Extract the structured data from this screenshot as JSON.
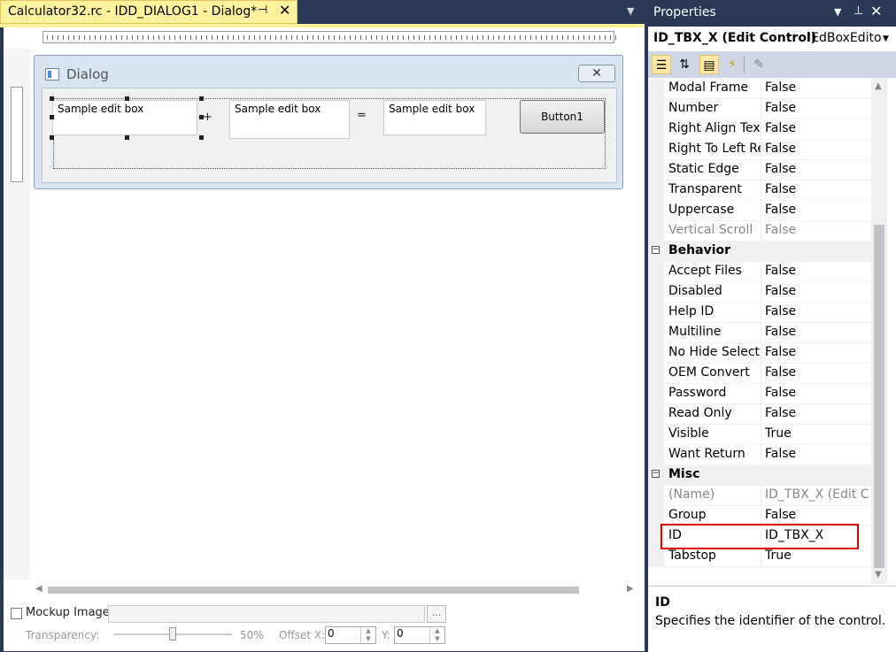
{
  "document": {
    "tab_title": "Calculator32.rc - IDD_DIALOG1 - Dialog*",
    "pin_icon": "pin-icon",
    "close_glyph": "✕"
  },
  "dialog": {
    "title": "Dialog",
    "close_glyph": "✕",
    "edit1_text": "Sample edit box",
    "plus": "+",
    "edit2_text": "Sample edit box",
    "equals": "=",
    "edit3_text": "Sample edit box",
    "button_label": "Button1"
  },
  "bottom_bar": {
    "mockup_label": "Mockup Image:",
    "mockup_path": "",
    "browse_label": "...",
    "transparency_label": "Transparency:",
    "transparency_percent": "50%",
    "transparency_value": 50,
    "offset_x_label": "Offset X:",
    "offset_x_value": "0",
    "y_label": "Y:",
    "y_value": "0"
  },
  "properties": {
    "title": "Properties",
    "selector_name": "ID_TBX_X (Edit Control)",
    "selector_type": "IEdBoxEditor",
    "rows": [
      {
        "name": "Modal Frame",
        "value": "False"
      },
      {
        "name": "Number",
        "value": "False"
      },
      {
        "name": "Right Align Text",
        "value": "False"
      },
      {
        "name": "Right To Left Reading",
        "value": "False"
      },
      {
        "name": "Static Edge",
        "value": "False"
      },
      {
        "name": "Transparent",
        "value": "False"
      },
      {
        "name": "Uppercase",
        "value": "False"
      },
      {
        "name": "Vertical Scroll",
        "value": "False"
      },
      {
        "category": "Behavior"
      },
      {
        "name": "Accept Files",
        "value": "False"
      },
      {
        "name": "Disabled",
        "value": "False"
      },
      {
        "name": "Help ID",
        "value": "False"
      },
      {
        "name": "Multiline",
        "value": "False"
      },
      {
        "name": "No Hide Selection",
        "value": "False"
      },
      {
        "name": "OEM Convert",
        "value": "False"
      },
      {
        "name": "Password",
        "value": "False"
      },
      {
        "name": "Read Only",
        "value": "False"
      },
      {
        "name": "Visible",
        "value": "True"
      },
      {
        "name": "Want Return",
        "value": "False"
      },
      {
        "category": "Misc"
      },
      {
        "name": "(Name)",
        "value": "ID_TBX_X (Edit Control)"
      },
      {
        "name": "Group",
        "value": "False"
      },
      {
        "name": "ID",
        "value": "ID_TBX_X"
      },
      {
        "name": "Tabstop",
        "value": "True"
      }
    ],
    "description_title": "ID",
    "description_text": "Specifies the identifier of the control.",
    "highlight_color": "#E00000",
    "accent_color": "#FFF29D"
  }
}
